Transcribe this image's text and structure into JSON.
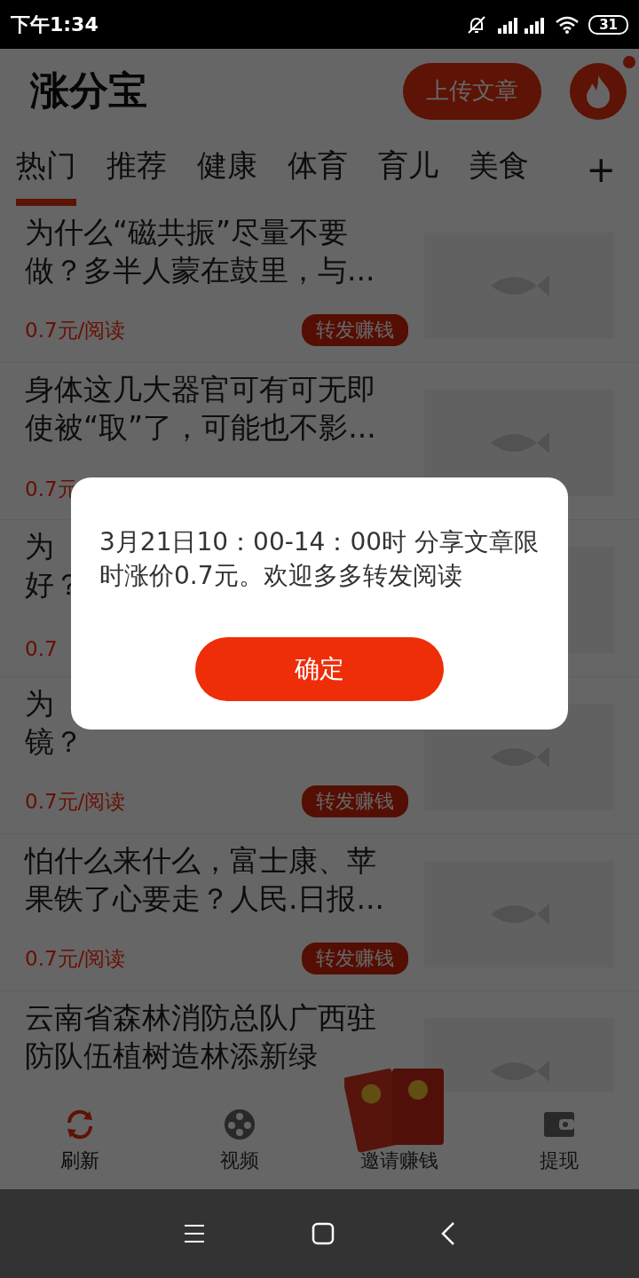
{
  "status_bar": {
    "time": "下午1:34",
    "battery": "31"
  },
  "header": {
    "title": "涨分宝",
    "upload_button": "上传文章",
    "notification_dot": true
  },
  "tabs": [
    {
      "label": "热门",
      "selected": true
    },
    {
      "label": "推荐",
      "selected": false
    },
    {
      "label": "健康",
      "selected": false
    },
    {
      "label": "体育",
      "selected": false
    },
    {
      "label": "育儿",
      "selected": false
    },
    {
      "label": "美食",
      "selected": false
    }
  ],
  "add_tab": "+",
  "articles": [
    {
      "title_lines": [
        "为什么“磁共振”尽量不要",
        "做？多半人蒙在鼓里，与..."
      ],
      "price": "0.7元/阅读",
      "tag": "转发赚钱"
    },
    {
      "title_lines": [
        "身体这几大器官可有可无即",
        "使被“取”了，可能也不影..."
      ],
      "price": "0.7元"
    },
    {
      "title_lines": [
        "为",
        "好？"
      ],
      "price": "0.7"
    },
    {
      "title_lines": [
        "为",
        "镜？"
      ],
      "price": "0.7元/阅读",
      "tag": "转发赚钱"
    },
    {
      "title_lines": [
        "怕什么来什么，富士康、苹",
        "果铁了心要走？人民.日报..."
      ],
      "price": "0.7元/阅读",
      "tag": "转发赚钱"
    },
    {
      "title_lines": [
        "云南省森林消防总队广西驻",
        "防队伍植树造林添新绿"
      ]
    }
  ],
  "bottom_nav": [
    {
      "kind": "refresh",
      "label": "刷新",
      "selected": true
    },
    {
      "kind": "video",
      "label": "视频",
      "selected": false
    },
    {
      "kind": "invite",
      "label": "邀请赚钱",
      "selected": false
    },
    {
      "kind": "wallet",
      "label": "提现",
      "selected": false
    }
  ],
  "dialog": {
    "message": "3月21日10：00-14：00时  分享文章限时涨价0.7元。欢迎多多转发阅读",
    "confirm": "确定"
  }
}
